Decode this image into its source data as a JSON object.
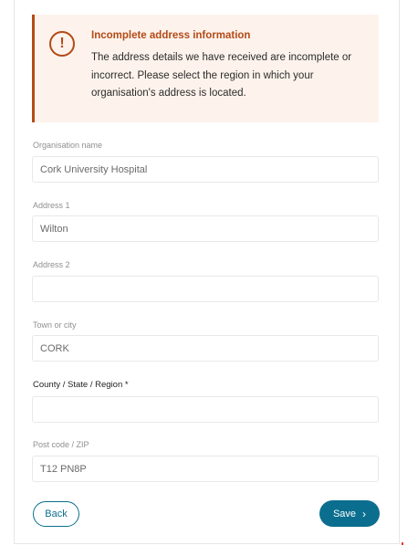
{
  "alert": {
    "icon": "warning-circle-icon",
    "icon_glyph": "!",
    "title": "Incomplete address information",
    "message": "The address details we have received are incomplete or incorrect. Please select the region in which your organisation's address is located."
  },
  "form": {
    "organisation_name": {
      "label": "Organisation name",
      "value": "Cork University Hospital"
    },
    "address1": {
      "label": "Address 1",
      "value": "Wilton"
    },
    "address2": {
      "label": "Address 2",
      "value": ""
    },
    "town": {
      "label": "Town or city",
      "value": "CORK"
    },
    "county": {
      "label": "County / State / Region *",
      "value": ""
    },
    "postcode": {
      "label": "Post code / ZIP",
      "value": "T12 PN8P"
    }
  },
  "actions": {
    "back_label": "Back",
    "save_label": "Save",
    "save_icon": "chevron-right-icon"
  },
  "colors": {
    "accent": "#0b6e8f",
    "warning": "#b44a17",
    "warning_bg": "#fdf3ec"
  }
}
